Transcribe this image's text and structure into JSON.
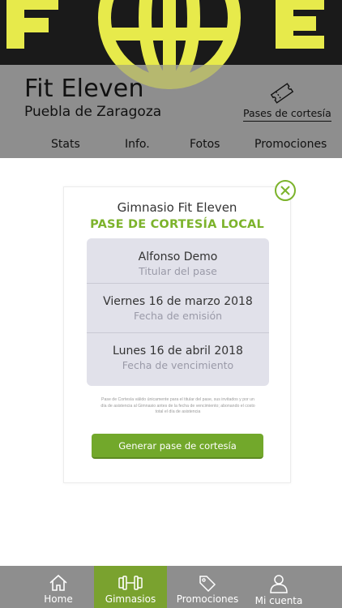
{
  "header": {
    "gym_name": "Fit Eleven",
    "city": "Puebla de Zaragoza",
    "courtesy_link": "Pases de cortesía",
    "logo_letters": "FOE",
    "logo_color": "#e7ea4b"
  },
  "tabs": [
    {
      "label": "Stats"
    },
    {
      "label": "Info."
    },
    {
      "label": "Fotos"
    },
    {
      "label": "Promociones"
    }
  ],
  "card": {
    "gym_title": "Gimnasio Fit Eleven",
    "pass_title": "PASE DE CORTESÍA LOCAL",
    "holder": {
      "value": "Alfonso Demo",
      "label": "Titular del pase"
    },
    "issued": {
      "value": "Viernes 16 de marzo 2018",
      "label": "Fecha de emisión"
    },
    "expires": {
      "value": "Lunes 16 de abril 2018",
      "label": "Fecha de vencimiento"
    },
    "fineprint": "Pase de Cortesía válido únicamente para el titular del pase, sus invitados y por un día de asistencia al Gimnasio antes de la fecha de vencimiento; abonando el costo total el día de asistencia",
    "button_label": "Generar pase de cortesía",
    "accent_color": "#7cb32b"
  },
  "bottom_nav": [
    {
      "label": "Home",
      "icon": "home-icon"
    },
    {
      "label": "Gimnasios",
      "icon": "dumbbell-icon",
      "active": true
    },
    {
      "label": "Promociones",
      "icon": "tag-icon"
    },
    {
      "label": "Mi cuenta",
      "icon": "user-icon"
    }
  ]
}
